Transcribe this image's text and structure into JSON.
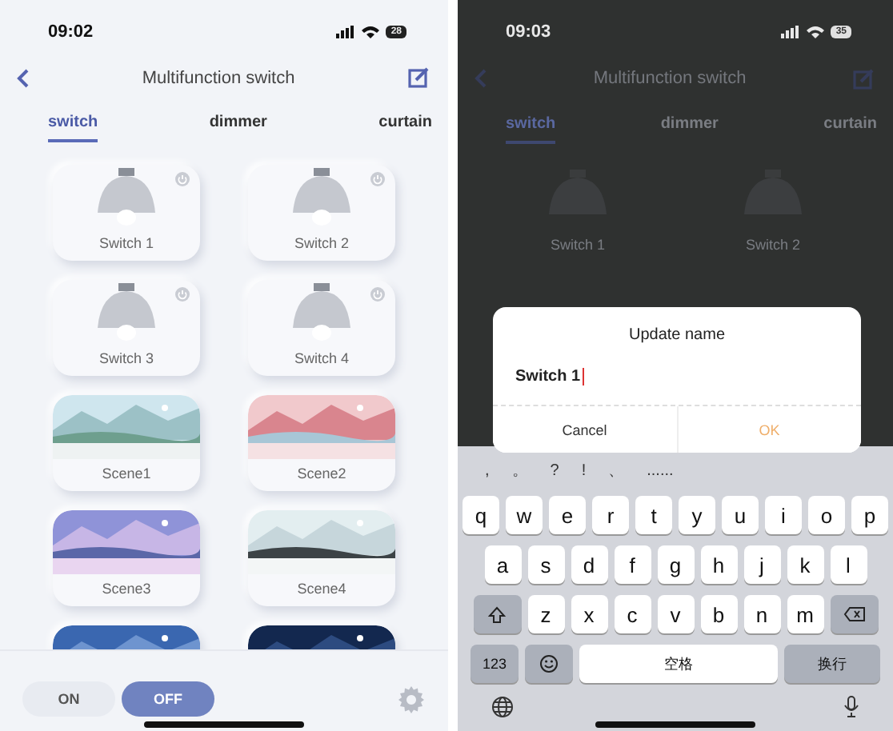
{
  "left_screen": {
    "status_bar": {
      "time": "09:02",
      "battery": "28"
    },
    "header": {
      "title": "Multifunction switch"
    },
    "tabs": [
      {
        "label": "switch",
        "selected": true
      },
      {
        "label": "dimmer",
        "selected": false
      },
      {
        "label": "curtain",
        "selected": false
      }
    ],
    "cards": [
      {
        "kind": "switch",
        "name": "Switch 1"
      },
      {
        "kind": "switch",
        "name": "Switch 2"
      },
      {
        "kind": "switch",
        "name": "Switch 3"
      },
      {
        "kind": "switch",
        "name": "Switch 4"
      },
      {
        "kind": "scene",
        "name": "Scene1"
      },
      {
        "kind": "scene",
        "name": "Scene2"
      },
      {
        "kind": "scene",
        "name": "Scene3"
      },
      {
        "kind": "scene",
        "name": "Scene4"
      },
      {
        "kind": "partial"
      },
      {
        "kind": "partial"
      }
    ],
    "power_buttons": [
      {
        "label": "ON",
        "selected": false
      },
      {
        "label": "OFF",
        "selected": true
      }
    ]
  },
  "right_screen": {
    "status_bar": {
      "time": "09:03",
      "battery": "35"
    },
    "header": {
      "title": "Multifunction switch"
    },
    "tabs": [
      {
        "label": "switch",
        "selected": true
      },
      {
        "label": "dimmer",
        "selected": false
      },
      {
        "label": "curtain",
        "selected": false
      }
    ],
    "cards": [
      {
        "kind": "switch",
        "name": "Switch 1"
      },
      {
        "kind": "switch",
        "name": "Switch 2"
      }
    ],
    "dialog": {
      "title": "Update name",
      "value": "Switch 1",
      "buttons": [
        {
          "label": "Cancel",
          "kind": "cancel"
        },
        {
          "label": "OK",
          "kind": "confirm"
        }
      ]
    },
    "keyboard": {
      "suggestions": [
        ",",
        "。",
        "?",
        "!",
        "、",
        "......"
      ],
      "rows": [
        [
          {
            "kind": "char",
            "label": "q"
          },
          {
            "kind": "char",
            "label": "w"
          },
          {
            "kind": "char",
            "label": "e"
          },
          {
            "kind": "char",
            "label": "r"
          },
          {
            "kind": "char",
            "label": "t"
          },
          {
            "kind": "char",
            "label": "y"
          },
          {
            "kind": "char",
            "label": "u"
          },
          {
            "kind": "char",
            "label": "i"
          },
          {
            "kind": "char",
            "label": "o"
          },
          {
            "kind": "char",
            "label": "p"
          }
        ],
        [
          {
            "kind": "char",
            "label": "a"
          },
          {
            "kind": "char",
            "label": "s"
          },
          {
            "kind": "char",
            "label": "d"
          },
          {
            "kind": "char",
            "label": "f"
          },
          {
            "kind": "char",
            "label": "g"
          },
          {
            "kind": "char",
            "label": "h"
          },
          {
            "kind": "char",
            "label": "j"
          },
          {
            "kind": "char",
            "label": "k"
          },
          {
            "kind": "char",
            "label": "l"
          }
        ],
        [
          {
            "kind": "shift"
          },
          {
            "kind": "char",
            "label": "z"
          },
          {
            "kind": "char",
            "label": "x"
          },
          {
            "kind": "char",
            "label": "c"
          },
          {
            "kind": "char",
            "label": "v"
          },
          {
            "kind": "char",
            "label": "b"
          },
          {
            "kind": "char",
            "label": "n"
          },
          {
            "kind": "char",
            "label": "m"
          },
          {
            "kind": "backspace"
          }
        ]
      ],
      "function_keys": [
        {
          "kind": "mode",
          "label": "123"
        },
        {
          "kind": "emoji"
        },
        {
          "kind": "space",
          "label": "空格"
        },
        {
          "kind": "return",
          "label": "换行"
        }
      ]
    }
  }
}
